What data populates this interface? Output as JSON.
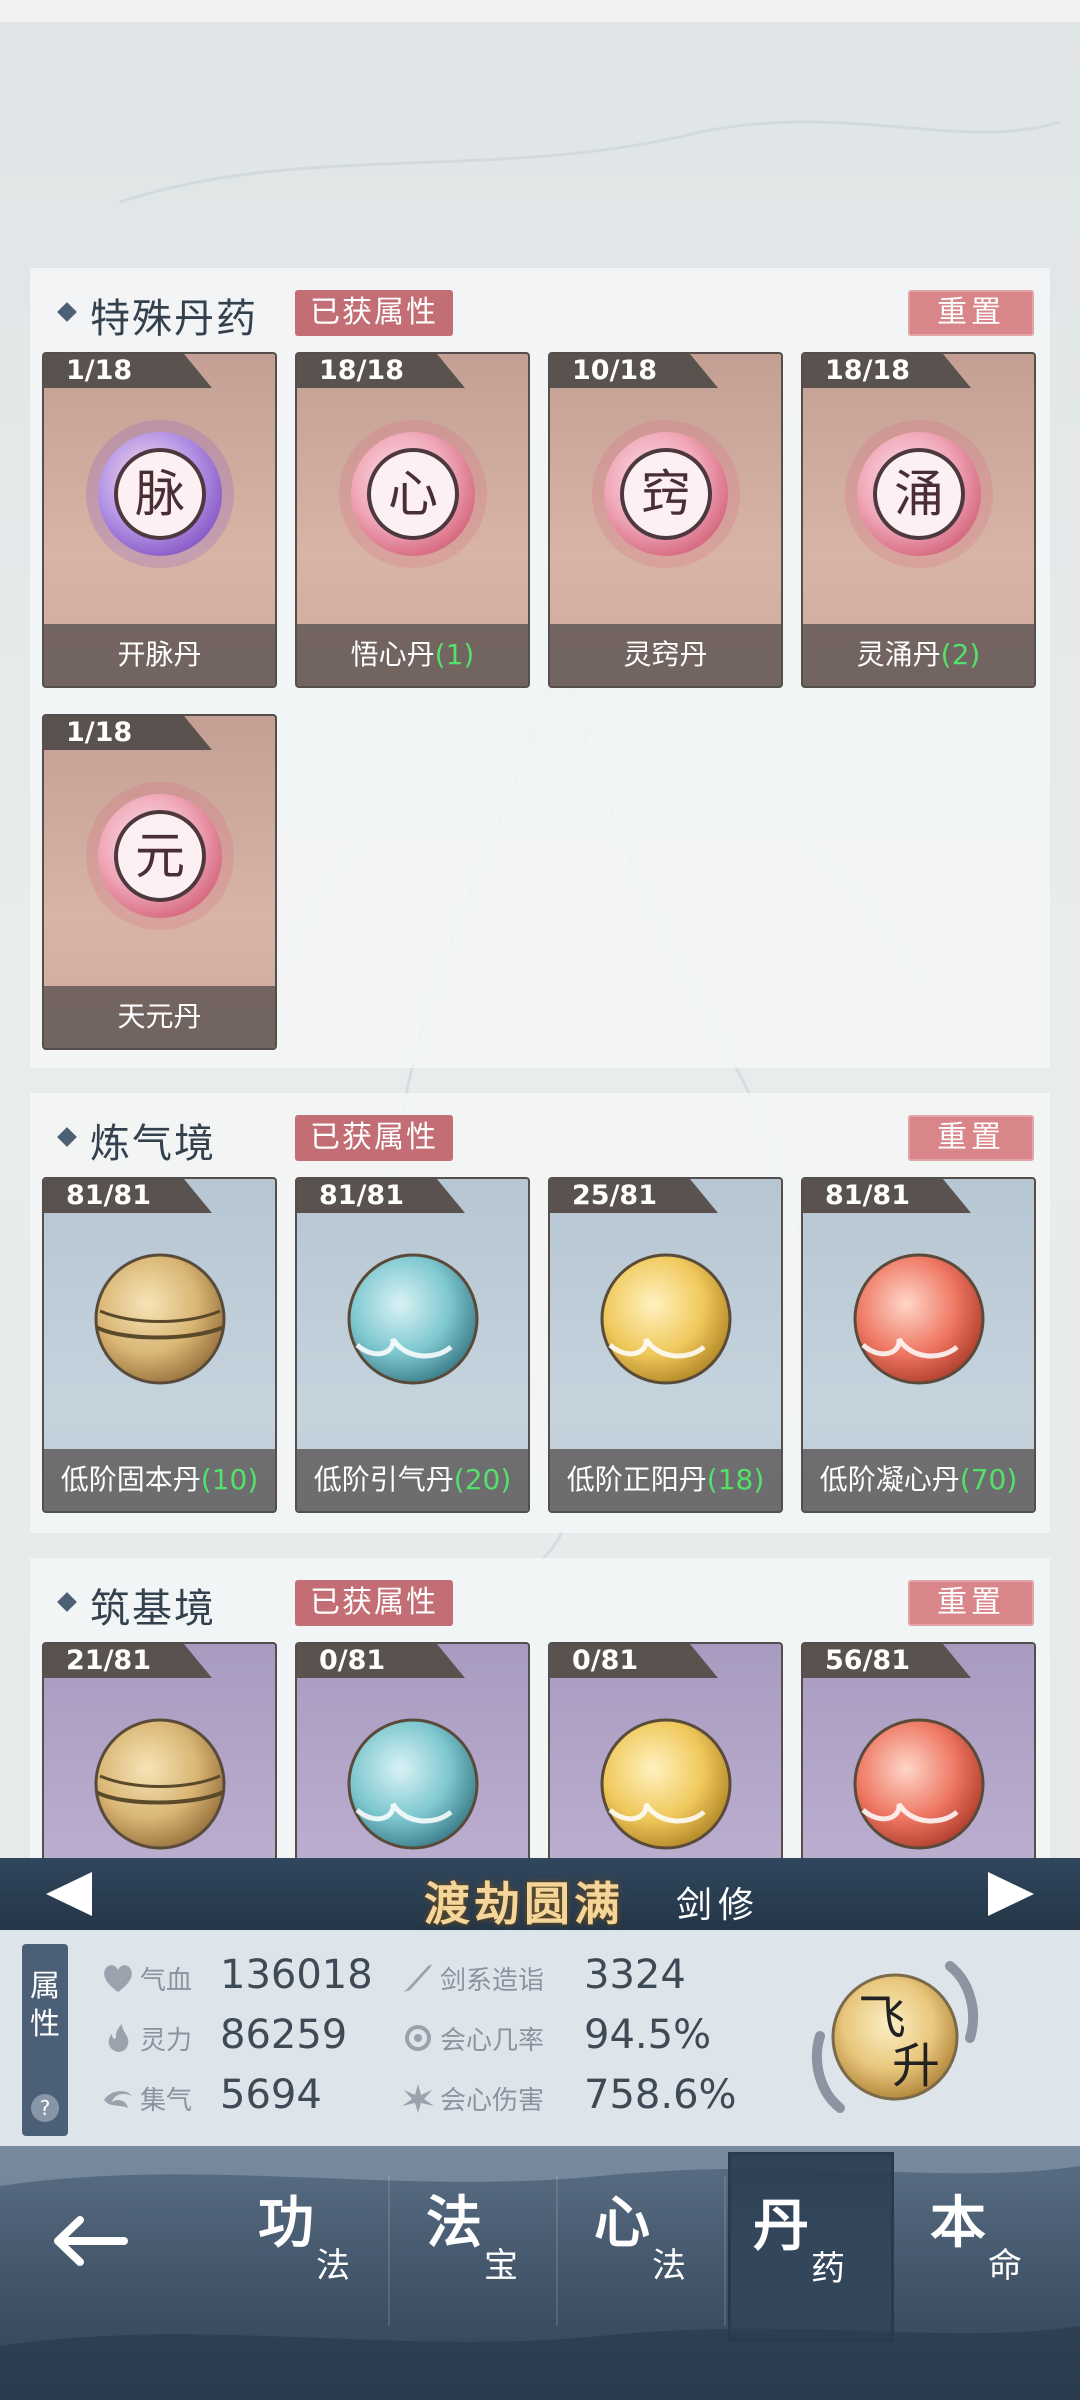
{
  "sections": {
    "special": {
      "title": "特殊丹药",
      "attr_tag": "已获属性",
      "reset": "重置",
      "items": [
        {
          "count": "1/18",
          "name": "开脉丹",
          "bonus": "",
          "glyph": "脉",
          "color": "#8a5cc8"
        },
        {
          "count": "18/18",
          "name": "悟心丹",
          "bonus": "(1)",
          "glyph": "心",
          "color": "#d66a80"
        },
        {
          "count": "10/18",
          "name": "灵窍丹",
          "bonus": "",
          "glyph": "窍",
          "color": "#d66a80"
        },
        {
          "count": "18/18",
          "name": "灵涌丹",
          "bonus": "(2)",
          "glyph": "涌",
          "color": "#d66a80"
        },
        {
          "count": "1/18",
          "name": "天元丹",
          "bonus": "",
          "glyph": "元",
          "color": "#d66a80"
        }
      ]
    },
    "lianqi": {
      "title": "炼气境",
      "attr_tag": "已获属性",
      "reset": "重置",
      "items": [
        {
          "count": "81/81",
          "name": "低阶固本丹",
          "bonus": "(10)",
          "orb": "gold-vine"
        },
        {
          "count": "81/81",
          "name": "低阶引气丹",
          "bonus": "(20)",
          "orb": "teal"
        },
        {
          "count": "25/81",
          "name": "低阶正阳丹",
          "bonus": "(18)",
          "orb": "gold"
        },
        {
          "count": "81/81",
          "name": "低阶凝心丹",
          "bonus": "(70)",
          "orb": "red"
        }
      ]
    },
    "zhuji": {
      "title": "筑基境",
      "attr_tag": "已获属性",
      "reset": "重置",
      "items": [
        {
          "count": "21/81",
          "orb": "gold-vine"
        },
        {
          "count": "0/81",
          "orb": "teal"
        },
        {
          "count": "0/81",
          "orb": "gold"
        },
        {
          "count": "56/81",
          "orb": "red"
        }
      ]
    }
  },
  "realm": {
    "name": "渡劫圆满",
    "class": "剑修"
  },
  "attributes": {
    "side_label": "属性",
    "help": "?",
    "stats": [
      {
        "icon": "heart-icon",
        "label": "气血",
        "value": "136018"
      },
      {
        "icon": "sword-icon",
        "label": "剑系造诣",
        "value": "3324"
      },
      {
        "icon": "flame-icon",
        "label": "灵力",
        "value": "86259"
      },
      {
        "icon": "crit-rate-icon",
        "label": "会心几率",
        "value": "94.5%"
      },
      {
        "icon": "swirl-icon",
        "label": "集气",
        "value": "5694"
      },
      {
        "icon": "burst-icon",
        "label": "会心伤害",
        "value": "758.6%"
      }
    ],
    "ascend_label": "飞升"
  },
  "nav": {
    "items": [
      {
        "big": "功",
        "small": "法"
      },
      {
        "big": "法",
        "small": "宝"
      },
      {
        "big": "心",
        "small": "法"
      },
      {
        "big": "丹",
        "small": "药",
        "active": true
      },
      {
        "big": "本",
        "small": "命"
      }
    ]
  },
  "colors": {
    "bonus_green": "#55e06a",
    "tag_red": "#c26e74",
    "realm_bar": "#2a3d52",
    "realm_gold": "#f4d69a"
  }
}
